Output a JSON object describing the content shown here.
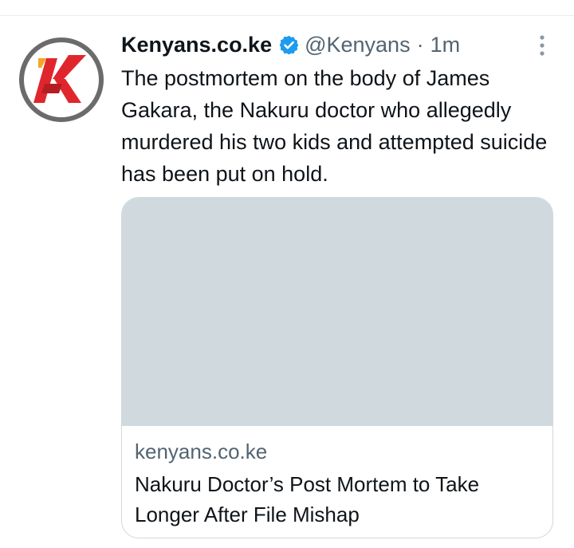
{
  "tweet": {
    "display_name": "Kenyans.co.ke",
    "handle": "@Kenyans",
    "separator": "·",
    "timestamp": "1m",
    "text": "The postmortem on the body of James Gakara, the Nakuru doctor who allegedly murdered his two kids and attempted suicide has been put on hold."
  },
  "card": {
    "domain": "kenyans.co.ke",
    "title": "Nakuru Doctor’s Post Mortem to Take Longer After File Mishap"
  },
  "icons": {
    "avatar": "kenyans-logo-icon",
    "verified": "verified-badge-icon",
    "more": "more-vertical-icon"
  },
  "colors": {
    "verified_blue": "#1d9bf0",
    "logo_red": "#e0262d",
    "logo_orange": "#f5a623",
    "secondary_text": "#536471",
    "card_image_placeholder": "#d0d9de"
  }
}
